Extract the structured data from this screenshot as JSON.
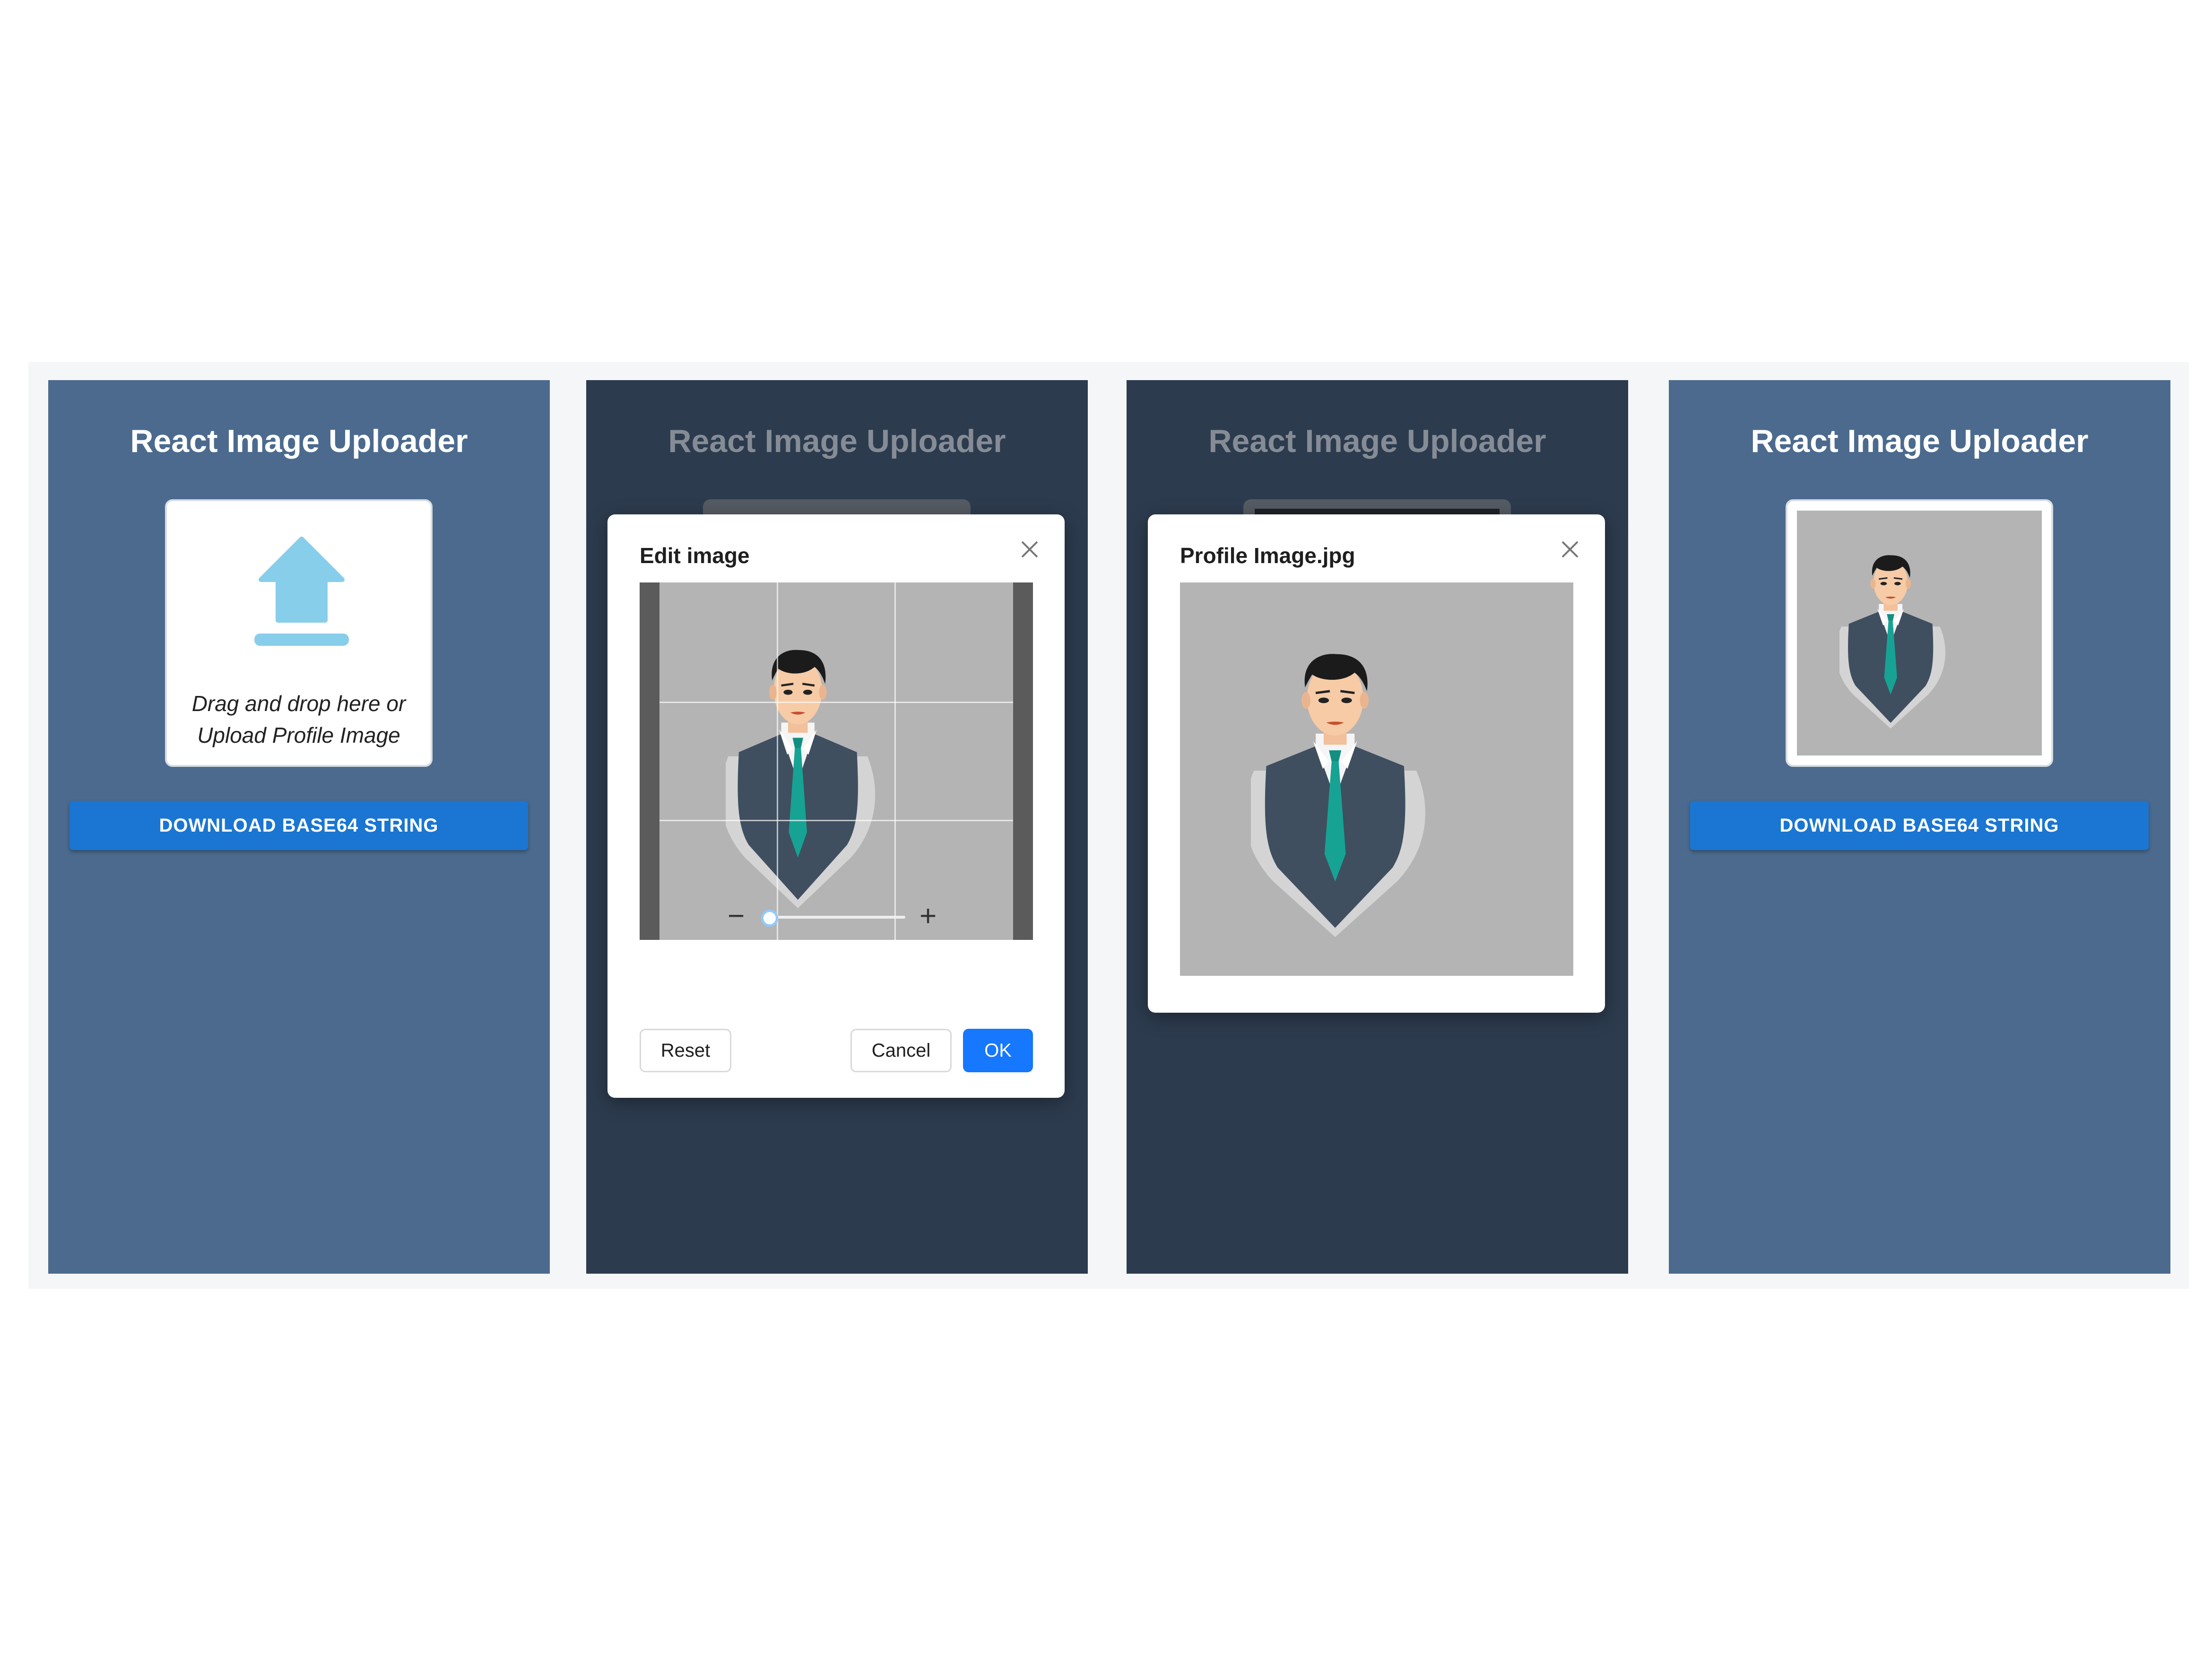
{
  "app_title": "React Image Uploader",
  "upload_box": {
    "line1": "Drag and drop here or",
    "line2": "Upload Profile Image",
    "icon": "upload-arrow-icon"
  },
  "download_button": "DOWNLOAD BASE64 STRING",
  "edit_modal": {
    "title": "Edit image",
    "zoom_minus": "−",
    "zoom_plus": "+",
    "zoom_level": 0,
    "reset_label": "Reset",
    "cancel_label": "Cancel",
    "ok_label": "OK"
  },
  "preview_modal": {
    "title": "Profile Image.jpg"
  },
  "colors": {
    "panel_light": "#4b6a8e",
    "panel_dark": "#2c3b4e",
    "accent_blue": "#1a76d2",
    "ok_blue": "#1677ff",
    "upload_icon": "#87ceeb",
    "tie": "#16a091",
    "vest": "#3d4d5e"
  }
}
